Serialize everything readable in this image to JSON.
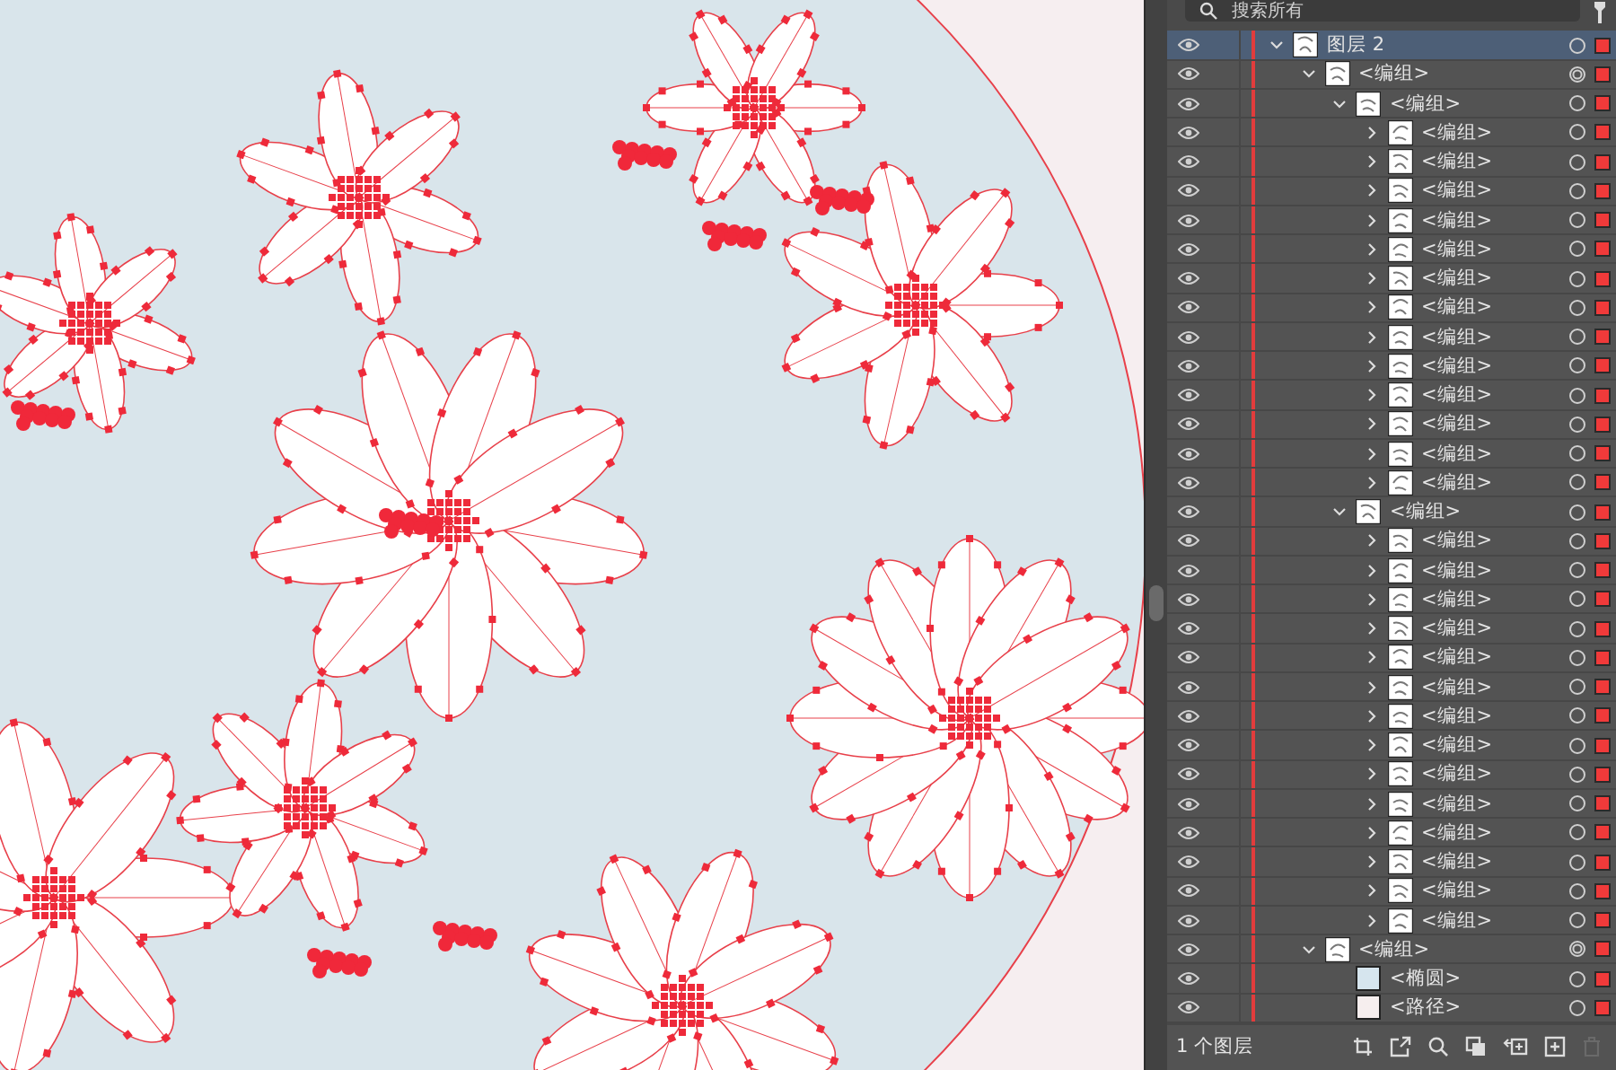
{
  "search": {
    "placeholder": "搜索所有"
  },
  "layers": [
    {
      "name": "图层 2",
      "selected": true,
      "expanded": true,
      "appearance": false,
      "children": [
        {
          "name": "<编组>",
          "selected": false,
          "expanded": true,
          "appearance": true,
          "children": [
            {
              "name": "<编组>",
              "selected": false,
              "expanded": true,
              "appearance": false,
              "children": [
                {
                  "name": "<编组>",
                  "selected": false,
                  "expanded": false,
                  "appearance": false
                },
                {
                  "name": "<编组>",
                  "selected": false,
                  "expanded": false,
                  "appearance": false
                },
                {
                  "name": "<编组>",
                  "selected": false,
                  "expanded": false,
                  "appearance": false
                },
                {
                  "name": "<编组>",
                  "selected": false,
                  "expanded": false,
                  "appearance": false
                },
                {
                  "name": "<编组>",
                  "selected": false,
                  "expanded": false,
                  "appearance": false
                },
                {
                  "name": "<编组>",
                  "selected": false,
                  "expanded": false,
                  "appearance": false
                },
                {
                  "name": "<编组>",
                  "selected": false,
                  "expanded": false,
                  "appearance": false
                },
                {
                  "name": "<编组>",
                  "selected": false,
                  "expanded": false,
                  "appearance": false
                },
                {
                  "name": "<编组>",
                  "selected": false,
                  "expanded": false,
                  "appearance": false
                },
                {
                  "name": "<编组>",
                  "selected": false,
                  "expanded": false,
                  "appearance": false
                },
                {
                  "name": "<编组>",
                  "selected": false,
                  "expanded": false,
                  "appearance": false
                },
                {
                  "name": "<编组>",
                  "selected": false,
                  "expanded": false,
                  "appearance": false
                },
                {
                  "name": "<编组>",
                  "selected": false,
                  "expanded": false,
                  "appearance": false
                }
              ]
            },
            {
              "name": "<编组>",
              "selected": false,
              "expanded": true,
              "appearance": false,
              "children": [
                {
                  "name": "<编组>",
                  "selected": false,
                  "expanded": false,
                  "appearance": false
                },
                {
                  "name": "<编组>",
                  "selected": false,
                  "expanded": false,
                  "appearance": false
                },
                {
                  "name": "<编组>",
                  "selected": false,
                  "expanded": false,
                  "appearance": false
                },
                {
                  "name": "<编组>",
                  "selected": false,
                  "expanded": false,
                  "appearance": false
                },
                {
                  "name": "<编组>",
                  "selected": false,
                  "expanded": false,
                  "appearance": false
                },
                {
                  "name": "<编组>",
                  "selected": false,
                  "expanded": false,
                  "appearance": false
                },
                {
                  "name": "<编组>",
                  "selected": false,
                  "expanded": false,
                  "appearance": false
                },
                {
                  "name": "<编组>",
                  "selected": false,
                  "expanded": false,
                  "appearance": false
                },
                {
                  "name": "<编组>",
                  "selected": false,
                  "expanded": false,
                  "appearance": false
                },
                {
                  "name": "<编组>",
                  "selected": false,
                  "expanded": false,
                  "appearance": false
                },
                {
                  "name": "<编组>",
                  "selected": false,
                  "expanded": false,
                  "appearance": false
                },
                {
                  "name": "<编组>",
                  "selected": false,
                  "expanded": false,
                  "appearance": false
                },
                {
                  "name": "<编组>",
                  "selected": false,
                  "expanded": false,
                  "appearance": false
                },
                {
                  "name": "<编组>",
                  "selected": false,
                  "expanded": false,
                  "appearance": false
                }
              ]
            }
          ]
        },
        {
          "name": "<编组>",
          "selected": false,
          "expanded": true,
          "appearance": true,
          "children": [
            {
              "name": "<椭圆>",
              "selected": false,
              "appearance": false,
              "color": "#d6e5ee"
            },
            {
              "name": "<路径>",
              "selected": false,
              "appearance": false,
              "color": "#f6eeee"
            }
          ]
        }
      ]
    }
  ],
  "footer": {
    "layer_count": "1 个图层"
  }
}
